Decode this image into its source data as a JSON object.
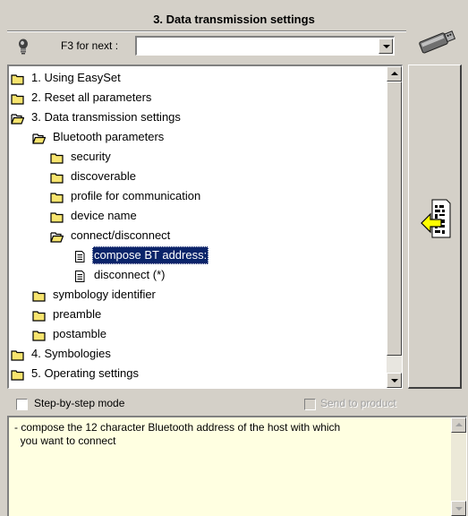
{
  "window": {
    "title": "3. Data transmission settings"
  },
  "search": {
    "label": "F3 for next :",
    "value": ""
  },
  "tree": {
    "items": [
      {
        "label": "1. Using EasySet",
        "icon": "folder-closed-icon",
        "level": 0,
        "selected": false
      },
      {
        "label": "2. Reset all parameters",
        "icon": "folder-closed-icon",
        "level": 0,
        "selected": false
      },
      {
        "label": "3. Data transmission settings",
        "icon": "folder-open-icon",
        "level": 0,
        "selected": false
      },
      {
        "label": "Bluetooth parameters",
        "icon": "folder-open-icon",
        "level": 1,
        "selected": false
      },
      {
        "label": "security",
        "icon": "folder-closed-icon",
        "level": 2,
        "selected": false
      },
      {
        "label": "discoverable",
        "icon": "folder-closed-icon",
        "level": 2,
        "selected": false
      },
      {
        "label": "profile for communication",
        "icon": "folder-closed-icon",
        "level": 2,
        "selected": false
      },
      {
        "label": "device name",
        "icon": "folder-closed-icon",
        "level": 2,
        "selected": false
      },
      {
        "label": "connect/disconnect",
        "icon": "folder-open-icon",
        "level": 2,
        "selected": false
      },
      {
        "label": "compose BT address:",
        "icon": "document-icon",
        "level": 3,
        "selected": true
      },
      {
        "label": "disconnect (*)",
        "icon": "document-icon",
        "level": 3,
        "selected": false
      },
      {
        "label": "symbology identifier",
        "icon": "folder-closed-icon",
        "level": 1,
        "selected": false
      },
      {
        "label": "preamble",
        "icon": "folder-closed-icon",
        "level": 1,
        "selected": false
      },
      {
        "label": "postamble",
        "icon": "folder-closed-icon",
        "level": 1,
        "selected": false
      },
      {
        "label": "4. Symbologies",
        "icon": "folder-closed-icon",
        "level": 0,
        "selected": false
      },
      {
        "label": "5. Operating settings",
        "icon": "folder-closed-icon",
        "level": 0,
        "selected": false
      }
    ]
  },
  "options": {
    "step_by_step_label": "Step-by-step mode",
    "step_by_step_checked": false,
    "send_to_product_label": "Send to product",
    "send_to_product_enabled": false
  },
  "description": {
    "text": "- compose the 12 character Bluetooth address of the host with which\n  you want to connect"
  },
  "colors": {
    "selection": "#0a246a",
    "folder": "#f7e46e",
    "description_bg": "#ffffe1",
    "arrow": "#ffff00"
  }
}
